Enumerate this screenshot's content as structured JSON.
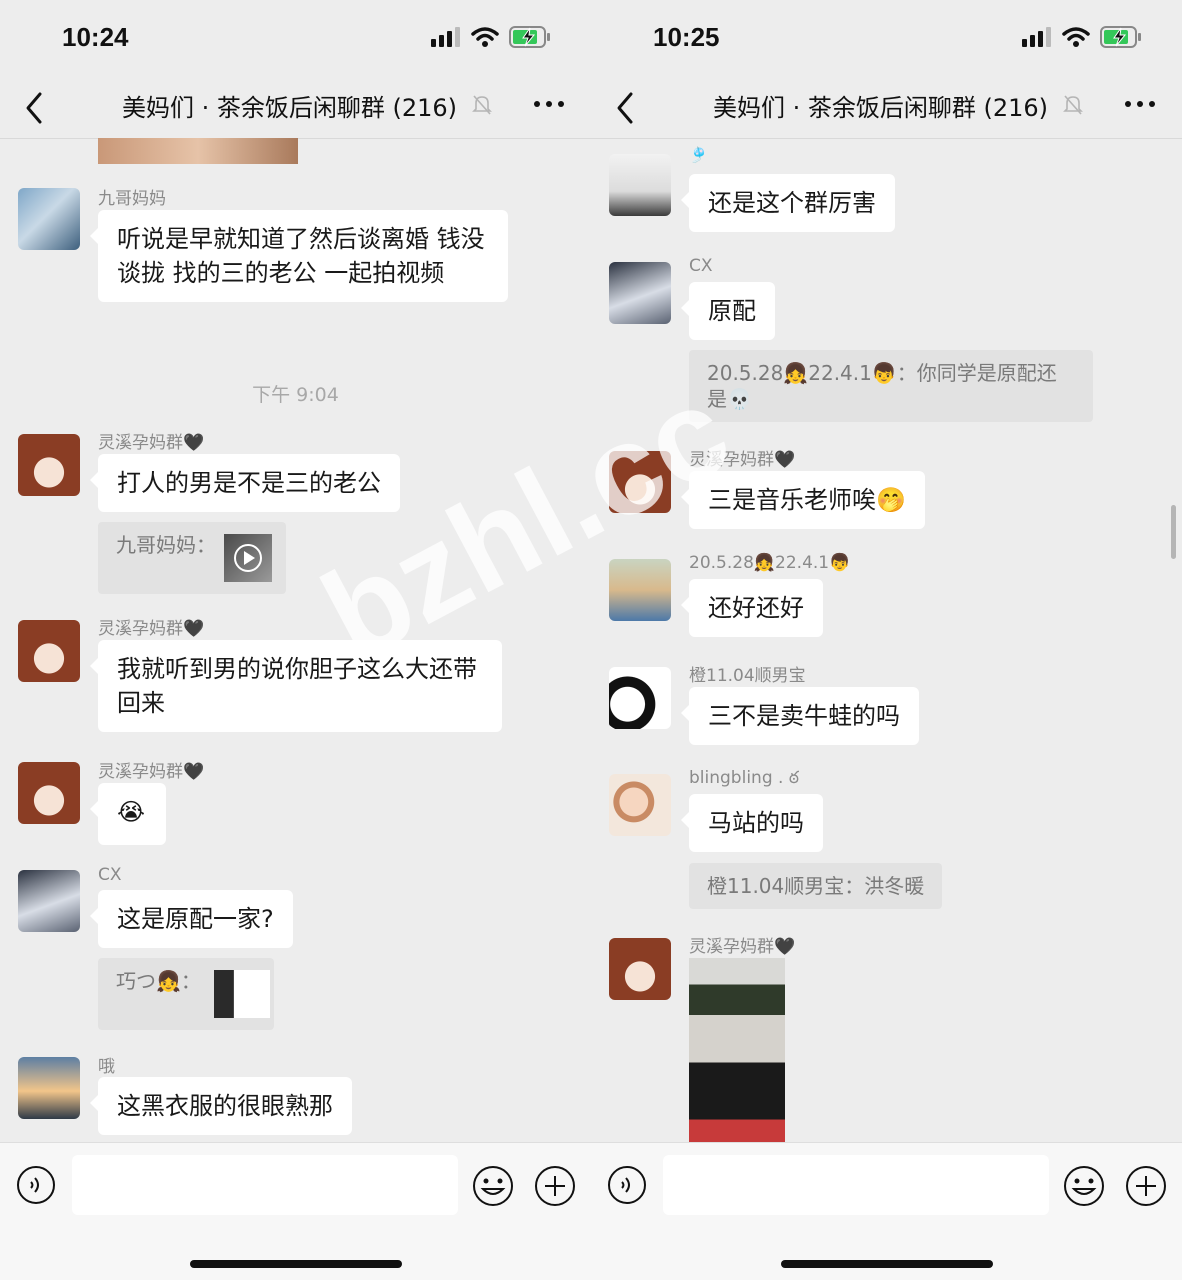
{
  "left": {
    "time": "10:24",
    "title": "美妈们 · 茶余饭后闲聊群 (216)",
    "messages": [
      {
        "sender": "九哥妈妈",
        "text": "听说是早就知道了然后谈离婚 钱没谈拢 找的三的老公 一起拍视频"
      },
      {
        "timestamp": "下午 9:04"
      },
      {
        "sender": "灵溪孕妈群🖤",
        "text": "打人的男是不是三的老公",
        "quote": "九哥妈妈："
      },
      {
        "sender": "灵溪孕妈群🖤",
        "text": "我就听到男的说你胆子这么大还带回来"
      },
      {
        "sender": "灵溪孕妈群🖤",
        "text": "😭"
      },
      {
        "sender": "CX",
        "text": "这是原配一家?",
        "quote": "巧つ👧："
      },
      {
        "sender": "哦",
        "text": "这黑衣服的很眼熟那"
      }
    ]
  },
  "right": {
    "time": "10:25",
    "title": "美妈们 · 茶余饭后闲聊群 (216)",
    "messages": [
      {
        "sender": "🎐",
        "text": "还是这个群厉害"
      },
      {
        "sender": "CX",
        "text": "原配",
        "quote": "20.5.28👧22.4.1👦：你同学是原配还是💀"
      },
      {
        "sender": "灵溪孕妈群🖤",
        "text": "三是音乐老师唉🤭"
      },
      {
        "sender": "20.5.28👧22.4.1👦",
        "text": "还好还好"
      },
      {
        "sender": "橙11.04顺男宝",
        "text": "三不是卖牛蛙的吗"
      },
      {
        "sender": "blingbling . ఠ",
        "text": "马站的吗",
        "quote": "橙11.04顺男宝：洪冬暖"
      },
      {
        "sender": "灵溪孕妈群🖤"
      }
    ]
  },
  "watermark": "bzhl.cc",
  "colors": {
    "background": "#ededed",
    "bubble": "#ffffff",
    "quote": "#e2e2e2",
    "battery": "#34c759"
  }
}
